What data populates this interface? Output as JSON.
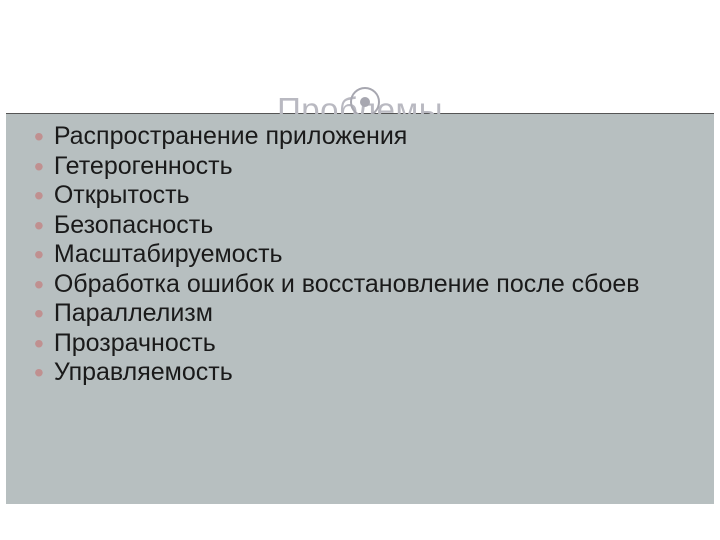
{
  "slide": {
    "title": "Проблемы",
    "bullets": [
      "Распространение приложения",
      "Гетерогенность",
      "Открытость",
      "Безопасность",
      "Масштабируемость",
      "Обработка ошибок и восстановление после сбоев",
      "Параллелизм",
      "Прозрачность",
      "Управляемость"
    ]
  }
}
